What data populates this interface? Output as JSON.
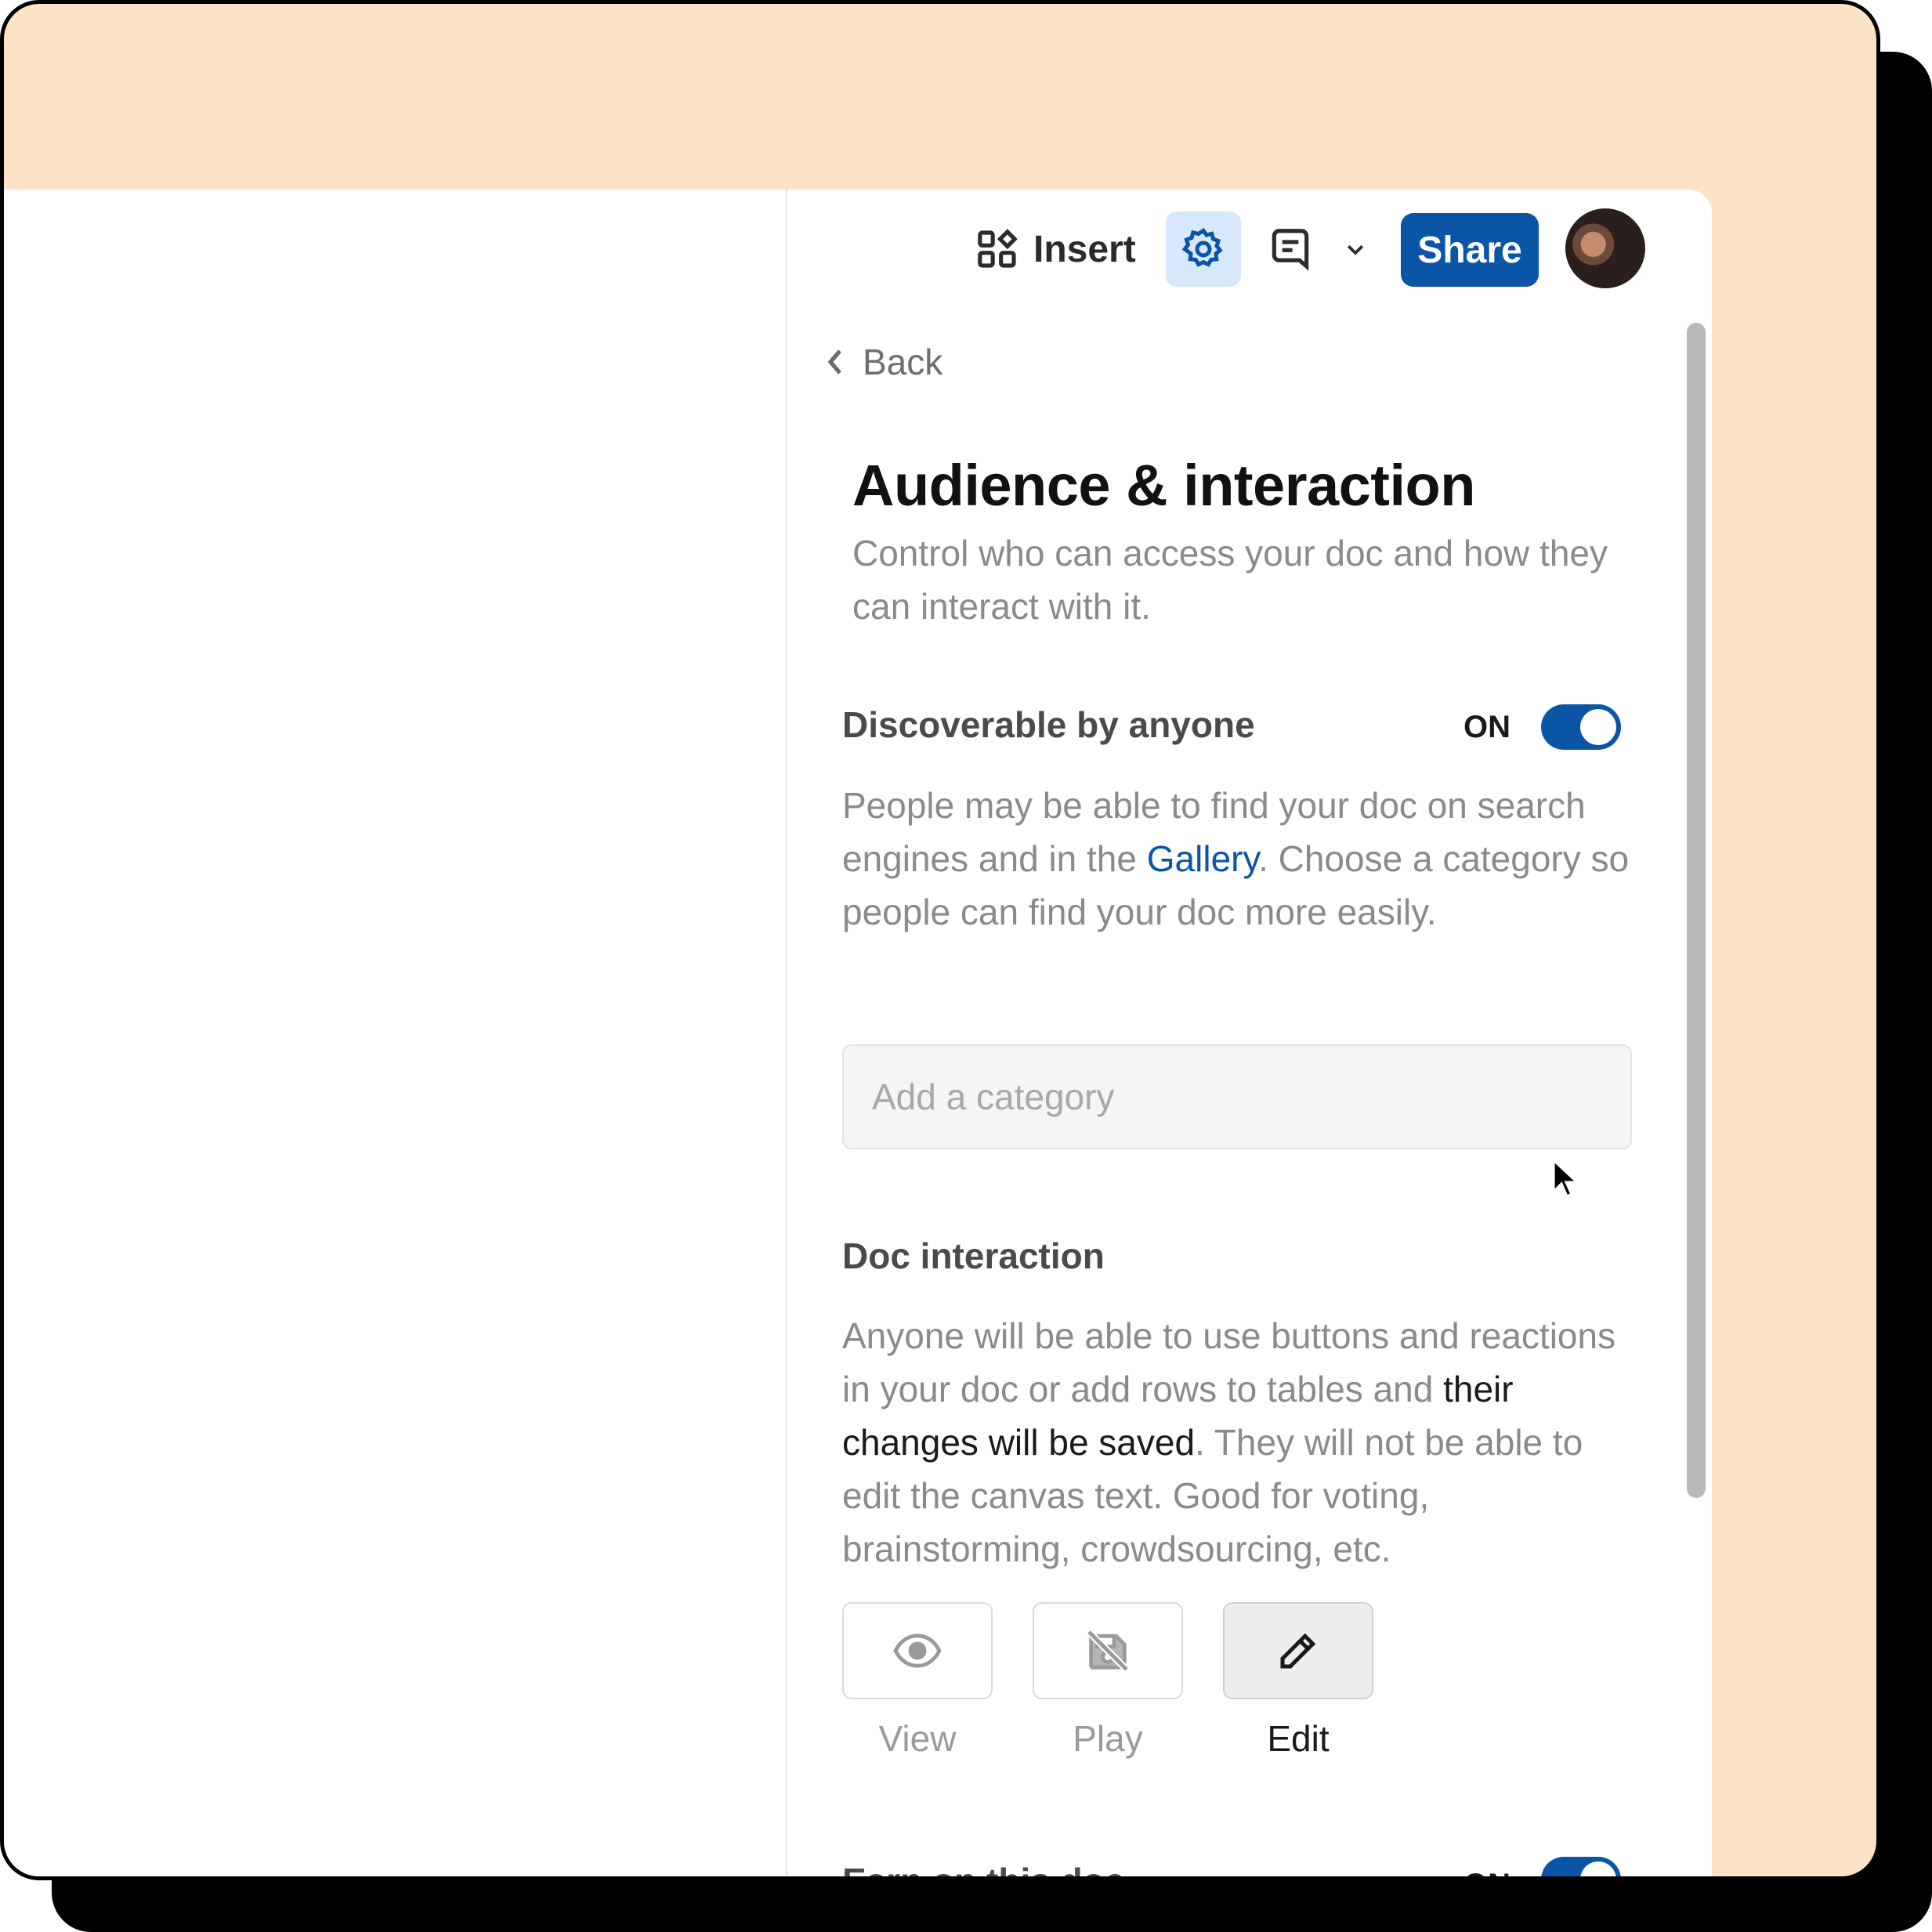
{
  "toolbar": {
    "insert_label": "Insert",
    "insert_icon": "grid-plus-icon",
    "settings_icon": "gear-icon",
    "comment_icon": "comment-icon",
    "dropdown_icon": "chevron-down-icon",
    "share_label": "Share",
    "avatar_icon": "user-avatar"
  },
  "panel": {
    "back_label": "Back",
    "title": "Audience & interaction",
    "subtitle": "Control who can access your doc and how they can interact with it."
  },
  "discoverable": {
    "title": "Discoverable by anyone",
    "toggle_state": "ON",
    "desc_before_link": "People may be able to find your doc on search engines and in the ",
    "link_text": "Gallery",
    "desc_after_link": ". Choose a category so people can find your doc more easily.",
    "category_placeholder": "Add a category"
  },
  "doc_interaction": {
    "title": "Doc interaction",
    "desc_part1": "Anyone will be able to use buttons and reactions in your doc or add rows to tables and ",
    "desc_emphasis": "their changes will be saved",
    "desc_part2": ". They will not be able to edit the canvas text. Good for voting, brainstorming, crowdsourcing, etc.",
    "modes": [
      {
        "label": "View",
        "icon": "eye-icon",
        "selected": false
      },
      {
        "label": "Play",
        "icon": "play-disabled-icon",
        "selected": false
      },
      {
        "label": "Edit",
        "icon": "pencil-icon",
        "selected": true
      }
    ]
  },
  "earn": {
    "title": "Earn on this doc",
    "toggle_state": "ON"
  },
  "colors": {
    "accent": "#0b55a7",
    "accent_light": "#d7e8fb",
    "frame_bg": "#fde3c6"
  }
}
